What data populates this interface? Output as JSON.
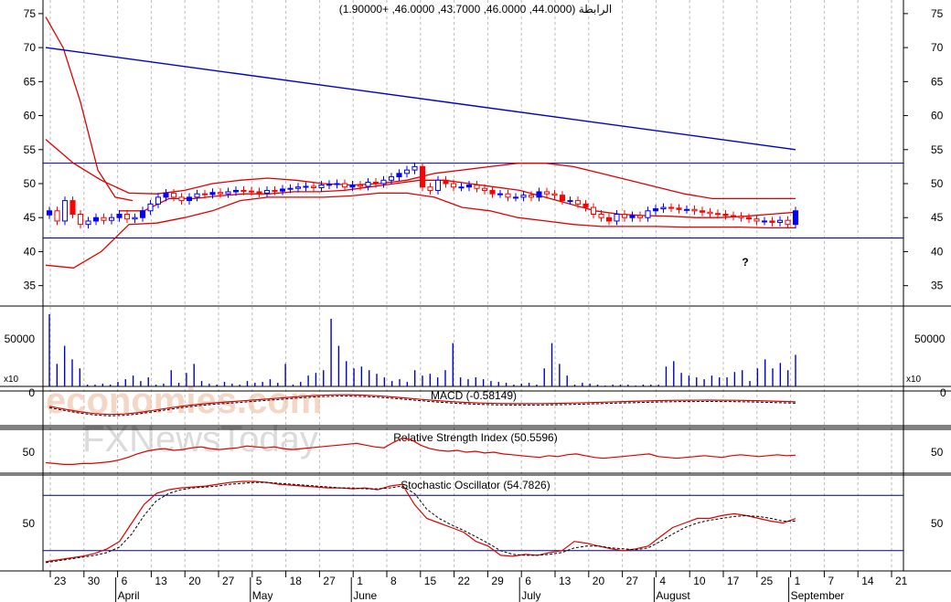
{
  "header": {
    "ohlc_text": "الرابطة (44.0000, 46.0000, 43.7000, 46.0000, +1.90000)",
    "watermark_line1": "economies.com",
    "watermark_line2": "FXNewsToday"
  },
  "colors": {
    "grid": "#000000",
    "price_line_red": "#e00000",
    "ma_blue": "#0000cc",
    "up_candle": "#0000ff",
    "down_candle": "#ff0000",
    "guide_line": "#000080"
  },
  "chart_data": [
    {
      "type": "candlestick",
      "title": "",
      "ylim": [
        32,
        77
      ],
      "yticks": [
        35,
        40,
        45,
        50,
        55,
        60,
        65,
        70,
        75
      ],
      "grid": true,
      "horizontal_levels": [
        53,
        42
      ],
      "annotation": "?",
      "close": [
        46.0,
        44.5,
        47.5,
        45.5,
        44.0,
        44.5,
        45.0,
        44.6,
        45.0,
        45.5,
        44.8,
        45.0,
        46.0,
        47.0,
        48.0,
        48.6,
        48.0,
        47.5,
        48.0,
        48.5,
        48.4,
        48.7,
        48.5,
        48.8,
        49.0,
        48.9,
        48.8,
        48.6,
        49.0,
        48.9,
        49.2,
        49.3,
        49.5,
        49.6,
        49.4,
        49.8,
        49.9,
        50.0,
        49.5,
        49.8,
        49.6,
        50.2,
        50.0,
        50.5,
        51.0,
        51.5,
        52.0,
        52.5,
        49.5,
        49.0,
        50.5,
        50.0,
        49.5,
        49.5,
        49.8,
        49.3,
        49.0,
        48.5,
        48.5,
        48.0,
        48.0,
        48.3,
        48.0,
        48.8,
        48.5,
        48.3,
        47.5,
        47.5,
        47.0,
        46.5,
        45.5,
        45.0,
        44.5,
        45.5,
        45.0,
        45.3,
        45.0,
        46.0,
        46.3,
        46.5,
        46.4,
        46.2,
        46.2,
        46.0,
        45.8,
        45.6,
        45.5,
        45.3,
        45.2,
        45.0,
        44.8,
        44.5,
        44.5,
        44.3,
        44.6,
        44.0,
        46.0
      ],
      "bollinger_upper": [
        56.5,
        53.0,
        50.5,
        48.6,
        48.5,
        49.0,
        50.0,
        50.5,
        50.8,
        50.5,
        50.0,
        49.8,
        50.0,
        50.5,
        51.5,
        52.0,
        52.5,
        53.0,
        53.0,
        52.5,
        51.5,
        50.5,
        49.5,
        48.5,
        47.8,
        47.8,
        47.8,
        47.8
      ],
      "bollinger_middle": [
        46.0,
        46.0,
        47.8,
        47.8,
        48.2,
        48.5,
        48.5,
        48.8,
        48.8,
        49.0,
        49.5,
        50.0,
        50.5,
        50.5,
        50.0,
        49.5,
        49.0,
        48.0,
        47.0,
        46.0,
        45.5,
        45.3,
        45.2,
        45.0,
        45.0,
        45.2,
        45.5,
        45.8
      ],
      "bollinger_lower": [
        38.0,
        37.6,
        40.0,
        44.0,
        44.2,
        45.0,
        46.0,
        47.5,
        48.0,
        48.0,
        48.0,
        48.2,
        48.6,
        48.6,
        48.0,
        46.5,
        46.0,
        45.0,
        44.5,
        44.0,
        43.7,
        43.7,
        43.7,
        43.6,
        43.6,
        43.6,
        43.5,
        43.5
      ],
      "upper_red_line": [
        74.5,
        70.0,
        62.0,
        52.0,
        48.0,
        47.5
      ],
      "moving_average_blue": [
        70.0,
        55.0
      ]
    },
    {
      "type": "bar",
      "title": "",
      "ytick_label": "50000",
      "scale_label": "x10",
      "values": [
        80,
        25,
        45,
        30,
        20,
        2,
        2,
        3,
        2,
        5,
        8,
        12,
        6,
        10,
        2,
        3,
        18,
        4,
        15,
        25,
        6,
        3,
        2,
        5,
        3,
        2,
        6,
        4,
        5,
        8,
        4,
        25,
        2,
        5,
        12,
        15,
        18,
        75,
        45,
        28,
        20,
        22,
        18,
        14,
        10,
        6,
        8,
        5,
        18,
        12,
        14,
        10,
        18,
        48,
        10,
        8,
        10,
        8,
        6,
        5,
        4,
        2,
        3,
        4,
        2,
        20,
        48,
        25,
        12,
        2,
        4,
        3,
        2,
        1,
        2,
        2,
        2,
        1,
        2,
        2,
        2,
        22,
        28,
        15,
        12,
        10,
        8,
        12,
        10,
        10,
        16,
        18,
        6,
        20,
        30,
        20,
        26,
        18,
        35
      ],
      "ylim": [
        0,
        80
      ]
    },
    {
      "type": "line",
      "title": "MACD (-0.58149)",
      "ytick_label": "0"
    },
    {
      "type": "line",
      "title": "Relative Strength Index (50.5596)",
      "ytick_label": "50",
      "rsi": [
        42,
        41,
        40,
        40,
        41,
        41,
        42,
        43,
        45,
        48,
        52,
        55,
        57,
        58,
        56,
        57,
        59,
        60,
        58,
        57,
        58,
        59,
        61,
        60,
        59,
        60,
        58,
        57,
        58,
        59,
        60,
        61,
        62,
        63,
        64,
        62,
        60,
        59,
        65,
        70,
        68,
        62,
        58,
        56,
        55,
        56,
        54,
        55,
        53,
        54,
        52,
        51,
        50,
        49,
        48,
        50,
        49,
        51,
        52,
        50,
        48,
        47,
        48,
        49,
        50,
        51,
        52,
        49,
        48,
        47,
        48,
        49,
        50,
        49,
        48,
        50,
        51,
        50,
        49,
        50,
        51,
        50,
        50.56
      ]
    },
    {
      "type": "line",
      "title": "Stochastic Oscillator (54.7826)",
      "ytick_label": "50",
      "k": [
        8,
        10,
        12,
        14,
        17,
        22,
        30,
        50,
        70,
        82,
        86,
        88,
        89,
        90,
        92,
        94,
        95,
        95,
        94,
        92,
        91,
        90,
        89,
        88,
        88,
        87,
        88,
        86,
        90,
        92,
        70,
        55,
        50,
        45,
        40,
        30,
        25,
        15,
        14,
        16,
        15,
        18,
        20,
        30,
        28,
        25,
        22,
        20,
        22,
        25,
        35,
        45,
        50,
        55,
        55,
        58,
        60,
        58,
        55,
        52,
        50,
        54.78
      ],
      "d": [
        7,
        9,
        11,
        13,
        15,
        18,
        24,
        38,
        58,
        74,
        82,
        86,
        88,
        89,
        90,
        92,
        93,
        94,
        94,
        93,
        92,
        91,
        90,
        89,
        88,
        88,
        87,
        87,
        88,
        90,
        82,
        65,
        55,
        48,
        42,
        35,
        28,
        20,
        16,
        15,
        15,
        16,
        18,
        23,
        25,
        25,
        23,
        22,
        21,
        23,
        30,
        38,
        45,
        50,
        53,
        55,
        57,
        58,
        57,
        55,
        52,
        52
      ]
    }
  ],
  "x_axis": {
    "day_labels": [
      "23",
      "30",
      "6",
      "13",
      "20",
      "27",
      "5",
      "18",
      "27",
      "1",
      "8",
      "15",
      "22",
      "29",
      "6",
      "13",
      "20",
      "27",
      "4",
      "10",
      "17",
      "25",
      "1",
      "7",
      "14",
      "21"
    ],
    "month_labels": [
      "April",
      "May",
      "June",
      "July",
      "August",
      "September"
    ]
  }
}
